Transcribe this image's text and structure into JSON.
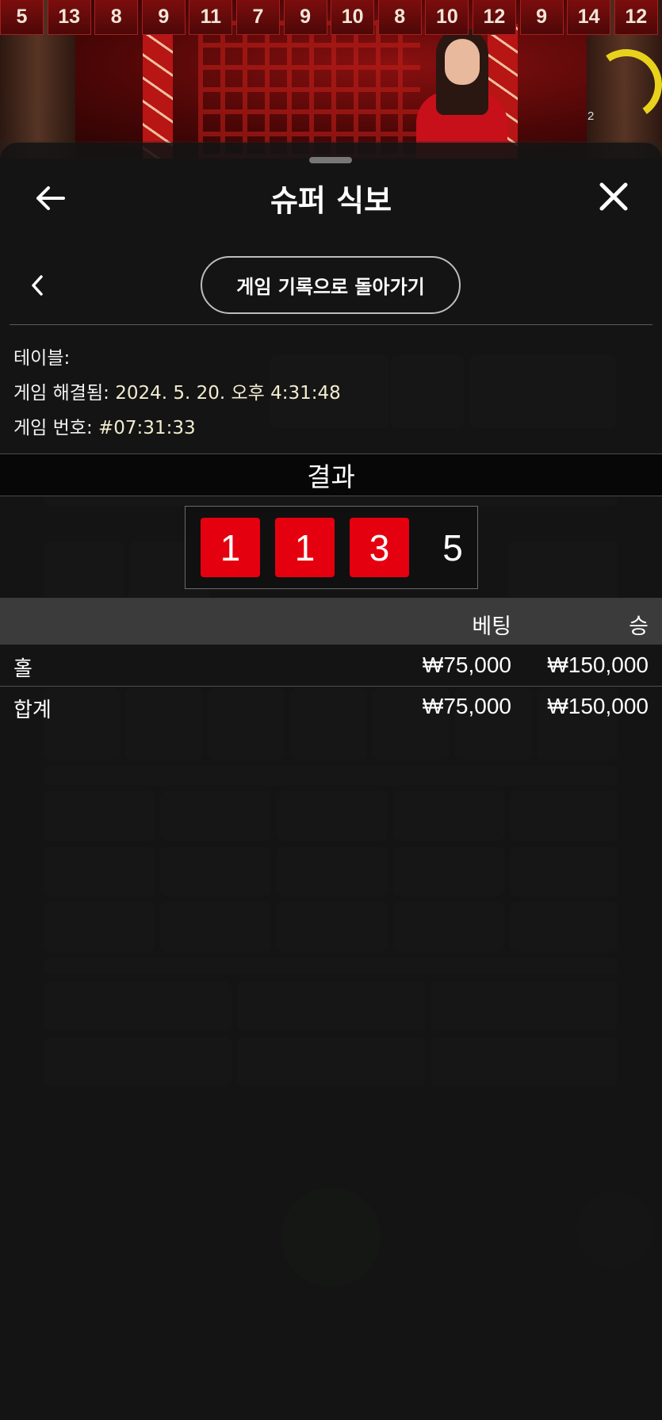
{
  "history": {
    "results": [
      "5",
      "13",
      "8",
      "9",
      "11",
      "7",
      "9",
      "10",
      "8",
      "10",
      "12",
      "9",
      "14",
      "12"
    ],
    "timer_value": "2"
  },
  "modal": {
    "title": "슈퍼 식보",
    "back_to_history_label": "게임 기록으로 돌아가기",
    "info": {
      "table_label": "테이블:",
      "resolved_label": "게임 해결됨:",
      "resolved_value": "2024. 5. 20. 오후 4:31:48",
      "game_number_label": "게임 번호:",
      "game_number_value": "#07:31:33"
    },
    "result_heading": "결과",
    "dice": [
      "1",
      "1",
      "3"
    ],
    "dice_total": "5",
    "table": {
      "col_bet": "베팅",
      "col_win": "승",
      "rows": [
        {
          "label": "홀",
          "bet": "₩75,000",
          "win": "₩150,000"
        }
      ],
      "total": {
        "label": "합계",
        "bet": "₩75,000",
        "win": "₩150,000"
      }
    }
  },
  "colors": {
    "die_red": "#e4000f",
    "timer_yellow": "#e8d21c",
    "sheet_bg": "#141414"
  },
  "icons": {
    "back": "arrow-left-icon",
    "close": "close-icon",
    "chevron": "chevron-left-icon"
  }
}
